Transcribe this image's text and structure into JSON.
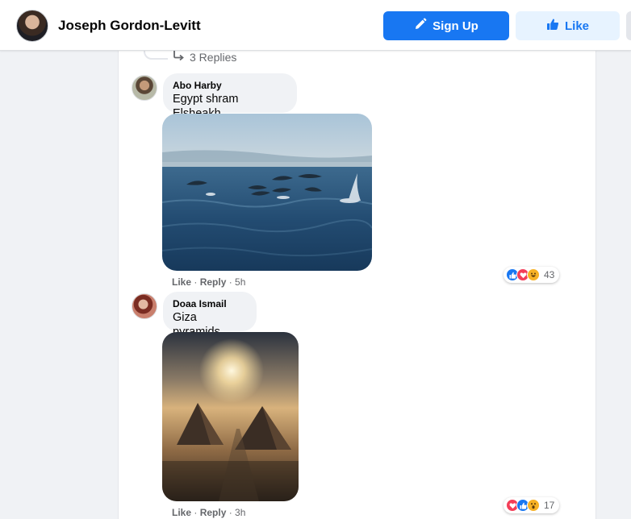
{
  "header": {
    "page_name": "Joseph Gordon-Levitt",
    "signup_label": "Sign Up",
    "like_label": "Like"
  },
  "thread": {
    "replies_label": "3 Replies"
  },
  "comments": [
    {
      "author": "Abo Harby",
      "text": "Egypt shram Elsheakh",
      "photo_icon": "dolphins-photo",
      "actions": {
        "like": "Like",
        "sep1": " · ",
        "reply": "Reply",
        "sep2": " · ",
        "time": "5h"
      },
      "reactions": [
        "like",
        "love",
        "haha"
      ],
      "reaction_count": "43"
    },
    {
      "author": "Doaa Ismail",
      "text": "Giza pyramids",
      "photo_icon": "pyramids-photo",
      "actions": {
        "like": "Like",
        "sep1": " · ",
        "reply": "Reply",
        "sep2": " · ",
        "time": "3h"
      },
      "reactions": [
        "love",
        "like",
        "wow"
      ],
      "reaction_count": "17"
    }
  ],
  "colors": {
    "brand": "#1877f2",
    "like_bg": "#e7f3ff",
    "bubble": "#f0f2f5",
    "meta_text": "#65676b"
  }
}
